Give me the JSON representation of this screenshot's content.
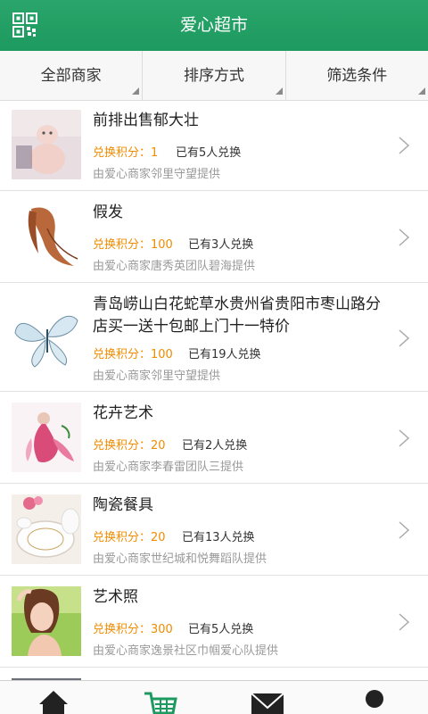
{
  "header": {
    "title": "爱心超市",
    "qr_icon": "qr-code-icon"
  },
  "filters": [
    {
      "label": "全部商家"
    },
    {
      "label": "排序方式"
    },
    {
      "label": "筛选条件"
    }
  ],
  "colors": {
    "brand": "#1d9a5f",
    "points": "#f08c00"
  },
  "items": [
    {
      "name": "前排出售郁大壮",
      "points": "兑换积分：1",
      "exchanged": "已有5人兑换",
      "provider": "由爱心商家邻里守望提供"
    },
    {
      "name": "假发",
      "points": "兑换积分：100",
      "exchanged": "已有3人兑换",
      "provider": "由爱心商家唐秀英团队碧海提供"
    },
    {
      "name": "青岛崂山白花蛇草水贵州省贵阳市枣山路分店买一送十包邮上门十一特价",
      "points": "兑换积分：100",
      "exchanged": "已有19人兑换",
      "provider": "由爱心商家邻里守望提供"
    },
    {
      "name": "花卉艺术",
      "points": "兑换积分：20",
      "exchanged": "已有2人兑换",
      "provider": "由爱心商家李春雷团队三提供"
    },
    {
      "name": "陶瓷餐具",
      "points": "兑换积分：20",
      "exchanged": "已有13人兑换",
      "provider": "由爱心商家世纪城和悦舞蹈队提供"
    },
    {
      "name": "艺术照",
      "points": "兑换积分：300",
      "exchanged": "已有5人兑换",
      "provider": "由爱心商家逸景社区巾帼爱心队提供"
    }
  ],
  "tabbar": [
    {
      "icon": "home-icon"
    },
    {
      "icon": "cart-icon"
    },
    {
      "icon": "mail-icon"
    },
    {
      "icon": "user-icon"
    }
  ]
}
